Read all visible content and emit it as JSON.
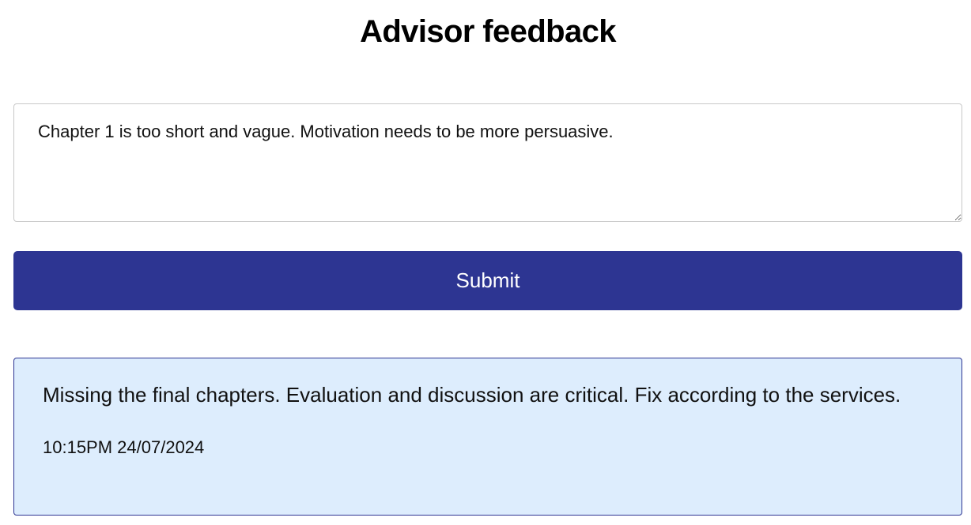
{
  "page": {
    "title": "Advisor feedback"
  },
  "form": {
    "feedback_value": "Chapter 1 is too short and vague. Motivation needs to be more persuasive.",
    "submit_label": "Submit"
  },
  "feedback_items": [
    {
      "message": "Missing the final chapters. Evaluation and discussion are critical. Fix according to the services.",
      "timestamp": "10:15PM 24/07/2024"
    }
  ],
  "colors": {
    "primary": "#2d3592",
    "card_background": "#ddedfd",
    "input_border": "#c8c8c8"
  }
}
